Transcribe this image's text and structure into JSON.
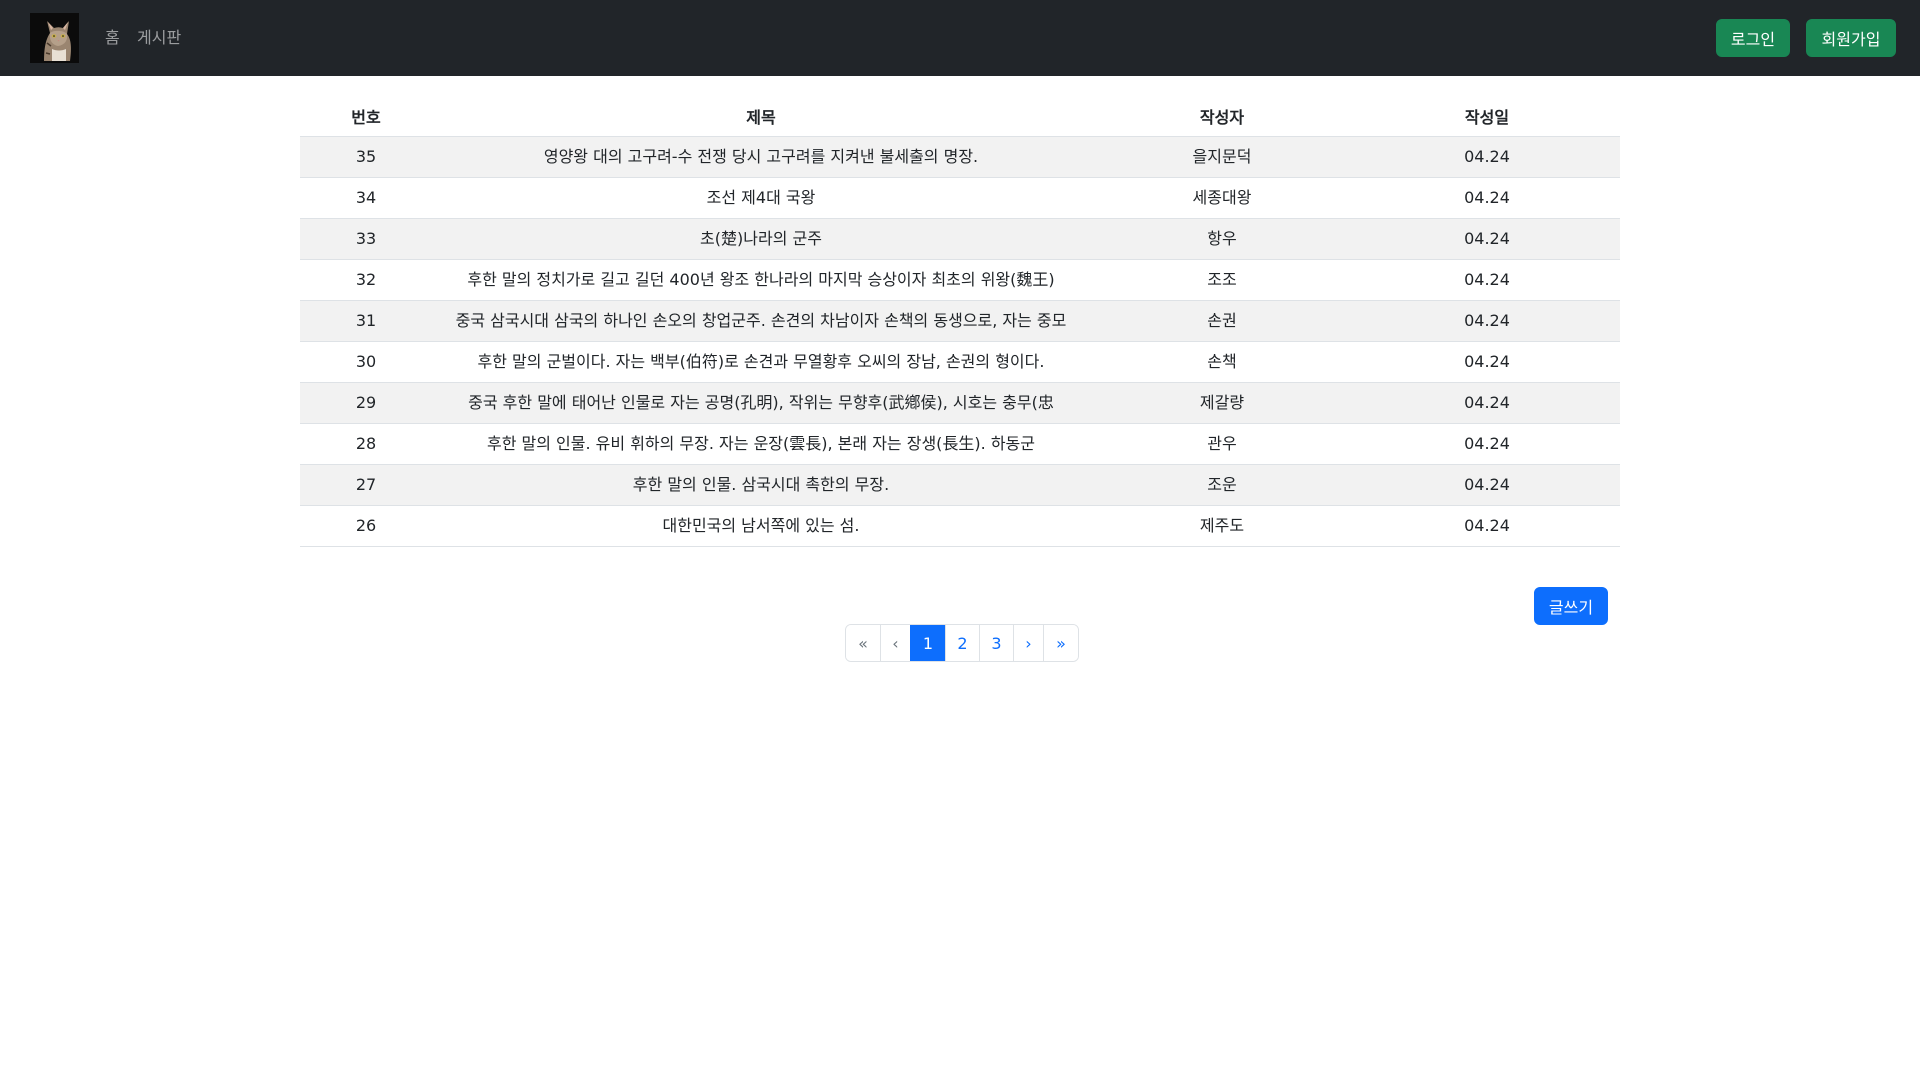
{
  "navbar": {
    "links": [
      "홈",
      "게시판"
    ],
    "login_label": "로그인",
    "signup_label": "회원가입"
  },
  "table": {
    "headers": [
      "번호",
      "제목",
      "작성자",
      "작성일"
    ],
    "rows": [
      {
        "num": "35",
        "title": "영양왕 대의 고구려-수 전쟁 당시 고구려를 지켜낸 불세출의 명장.",
        "author": "을지문덕",
        "date": "04.24"
      },
      {
        "num": "34",
        "title": "조선 제4대 국왕",
        "author": "세종대왕",
        "date": "04.24"
      },
      {
        "num": "33",
        "title": "초(楚)나라의 군주",
        "author": "항우",
        "date": "04.24"
      },
      {
        "num": "32",
        "title": "후한 말의 정치가로 길고 길던 400년 왕조 한나라의 마지막 승상이자 최초의 위왕(魏王)",
        "author": "조조",
        "date": "04.24"
      },
      {
        "num": "31",
        "title": "중국 삼국시대 삼국의 하나인 손오의 창업군주. 손견의 차남이자 손책의 동생으로, 자는 중모",
        "author": "손권",
        "date": "04.24"
      },
      {
        "num": "30",
        "title": "후한 말의 군벌이다. 자는 백부(伯符)로 손견과 무열황후 오씨의 장남, 손권의 형이다.",
        "author": "손책",
        "date": "04.24"
      },
      {
        "num": "29",
        "title": "중국 후한 말에 태어난 인물로 자는 공명(孔明), 작위는 무향후(武鄕侯), 시호는 충무(忠",
        "author": "제갈량",
        "date": "04.24"
      },
      {
        "num": "28",
        "title": "후한 말의 인물. 유비 휘하의 무장. 자는 운장(雲長), 본래 자는 장생(長生). 하동군",
        "author": "관우",
        "date": "04.24"
      },
      {
        "num": "27",
        "title": "후한 말의 인물. 삼국시대 촉한의 무장.",
        "author": "조운",
        "date": "04.24"
      },
      {
        "num": "26",
        "title": "대한민국의 남서쪽에 있는 섬.",
        "author": "제주도",
        "date": "04.24"
      }
    ]
  },
  "write_label": "글쓰기",
  "pagination": {
    "items": [
      "«",
      "‹",
      "1",
      "2",
      "3",
      "›",
      "»"
    ],
    "active_page": "1"
  }
}
